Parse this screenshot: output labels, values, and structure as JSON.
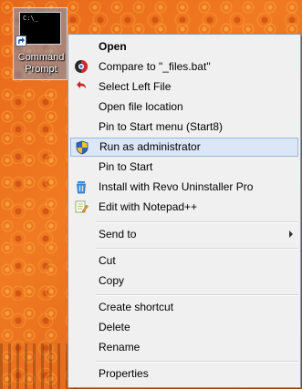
{
  "desktop": {
    "icon_label": "Command\nPrompt",
    "thumb_text": "C:\\_"
  },
  "menu": {
    "items": [
      {
        "label": "Open",
        "icon": "none",
        "bold": true
      },
      {
        "label": "Compare to \"_files.bat\"",
        "icon": "beyond-compare-icon"
      },
      {
        "label": "Select Left File",
        "icon": "undo-arrow-icon"
      },
      {
        "label": "Open file location",
        "icon": "none"
      },
      {
        "label": "Pin to Start menu (Start8)",
        "icon": "none"
      },
      {
        "label": "Run as administrator",
        "icon": "uac-shield-icon",
        "highlighted": true
      },
      {
        "label": "Pin to Start",
        "icon": "none"
      },
      {
        "label": "Install with Revo Uninstaller Pro",
        "icon": "revo-uninstaller-icon"
      },
      {
        "label": "Edit with Notepad++",
        "icon": "notepad-plus-plus-icon"
      },
      {
        "label": "Send to",
        "icon": "none",
        "submenu": true
      },
      {
        "label": "Cut",
        "icon": "none"
      },
      {
        "label": "Copy",
        "icon": "none"
      },
      {
        "label": "Create shortcut",
        "icon": "none"
      },
      {
        "label": "Delete",
        "icon": "none"
      },
      {
        "label": "Rename",
        "icon": "none"
      },
      {
        "label": "Properties",
        "icon": "none"
      }
    ]
  },
  "colors": {
    "highlight_bg": "#dbe7f7",
    "highlight_border": "#99b8e0",
    "menu_bg": "#f0f0f0",
    "desktop_bg": "#e2641a"
  }
}
